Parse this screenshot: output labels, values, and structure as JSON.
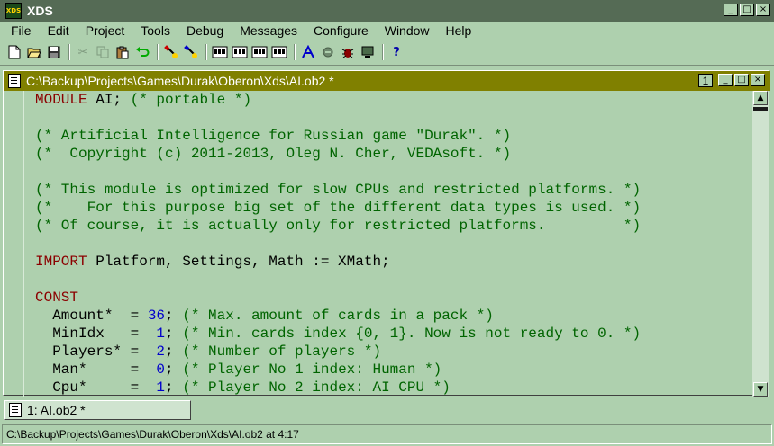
{
  "app": {
    "title": "XDS",
    "icon_label": "XDS",
    "window_buttons": [
      "_",
      "□",
      "×"
    ]
  },
  "menu": [
    "File",
    "Edit",
    "Project",
    "Tools",
    "Debug",
    "Messages",
    "Configure",
    "Window",
    "Help"
  ],
  "toolbar": {
    "icons": [
      "new-file-icon",
      "open-folder-icon",
      "save-icon",
      "cut-icon",
      "copy-icon",
      "paste-icon",
      "undo-icon",
      "compile-icon",
      "make-icon",
      "build-icon-1",
      "build-icon-2",
      "build-icon-3",
      "build-icon-4",
      "debug-run-icon",
      "stop-icon",
      "bug-icon",
      "monitor-icon",
      "help-icon"
    ],
    "help_label": "?"
  },
  "editor": {
    "path": "C:\\Backup\\Projects\\Games\\Durak\\Oberon\\Xds\\AI.ob2 *",
    "window_number": "1",
    "lines": [
      [
        {
          "t": "kw",
          "v": "MODULE"
        },
        {
          "t": "tx",
          "v": " AI; "
        },
        {
          "t": "cm",
          "v": "(* portable *)"
        }
      ],
      [],
      [
        {
          "t": "cm",
          "v": "(* Artificial Intelligence for Russian game \"Durak\". *)"
        }
      ],
      [
        {
          "t": "cm",
          "v": "(*  Copyright (c) 2011-2013, Oleg N. Cher, VEDAsoft. *)"
        }
      ],
      [],
      [
        {
          "t": "cm",
          "v": "(* This module is optimized for slow CPUs and restricted platforms. *)"
        }
      ],
      [
        {
          "t": "cm",
          "v": "(*    For this purpose big set of the different data types is used. *)"
        }
      ],
      [
        {
          "t": "cm",
          "v": "(* Of course, it is actually only for restricted platforms.         *)"
        }
      ],
      [],
      [
        {
          "t": "kw",
          "v": "IMPORT"
        },
        {
          "t": "tx",
          "v": " Platform, Settings, Math := XMath;"
        }
      ],
      [],
      [
        {
          "t": "kw",
          "v": "CONST"
        }
      ],
      [
        {
          "t": "tx",
          "v": "  Amount*  = "
        },
        {
          "t": "nm",
          "v": "36"
        },
        {
          "t": "tx",
          "v": "; "
        },
        {
          "t": "cm",
          "v": "(* Max. amount of cards in a pack *)"
        }
      ],
      [
        {
          "t": "tx",
          "v": "  MinIdx   =  "
        },
        {
          "t": "nm",
          "v": "1"
        },
        {
          "t": "tx",
          "v": "; "
        },
        {
          "t": "cm",
          "v": "(* Min. cards index {0, 1}. Now is not ready to 0. *)"
        }
      ],
      [
        {
          "t": "tx",
          "v": "  Players* =  "
        },
        {
          "t": "nm",
          "v": "2"
        },
        {
          "t": "tx",
          "v": "; "
        },
        {
          "t": "cm",
          "v": "(* Number of players *)"
        }
      ],
      [
        {
          "t": "tx",
          "v": "  Man*     =  "
        },
        {
          "t": "nm",
          "v": "0"
        },
        {
          "t": "tx",
          "v": "; "
        },
        {
          "t": "cm",
          "v": "(* Player No 1 index: Human *)"
        }
      ],
      [
        {
          "t": "tx",
          "v": "  Cpu*     =  "
        },
        {
          "t": "nm",
          "v": "1"
        },
        {
          "t": "tx",
          "v": "; "
        },
        {
          "t": "cm",
          "v": "(* Player No 2 index: AI CPU *)"
        }
      ]
    ]
  },
  "window_bar": {
    "tab_label": "1: AI.ob2 *"
  },
  "status": {
    "text": "C:\\Backup\\Projects\\Games\\Durak\\Oberon\\Xds\\AI.ob2 at 4:17"
  },
  "colors": {
    "background": "#aed0ae",
    "title_bar": "#556b55",
    "editor_title": "#808000",
    "keyword": "#8b0000",
    "comment": "#006400",
    "number": "#0000cc"
  }
}
